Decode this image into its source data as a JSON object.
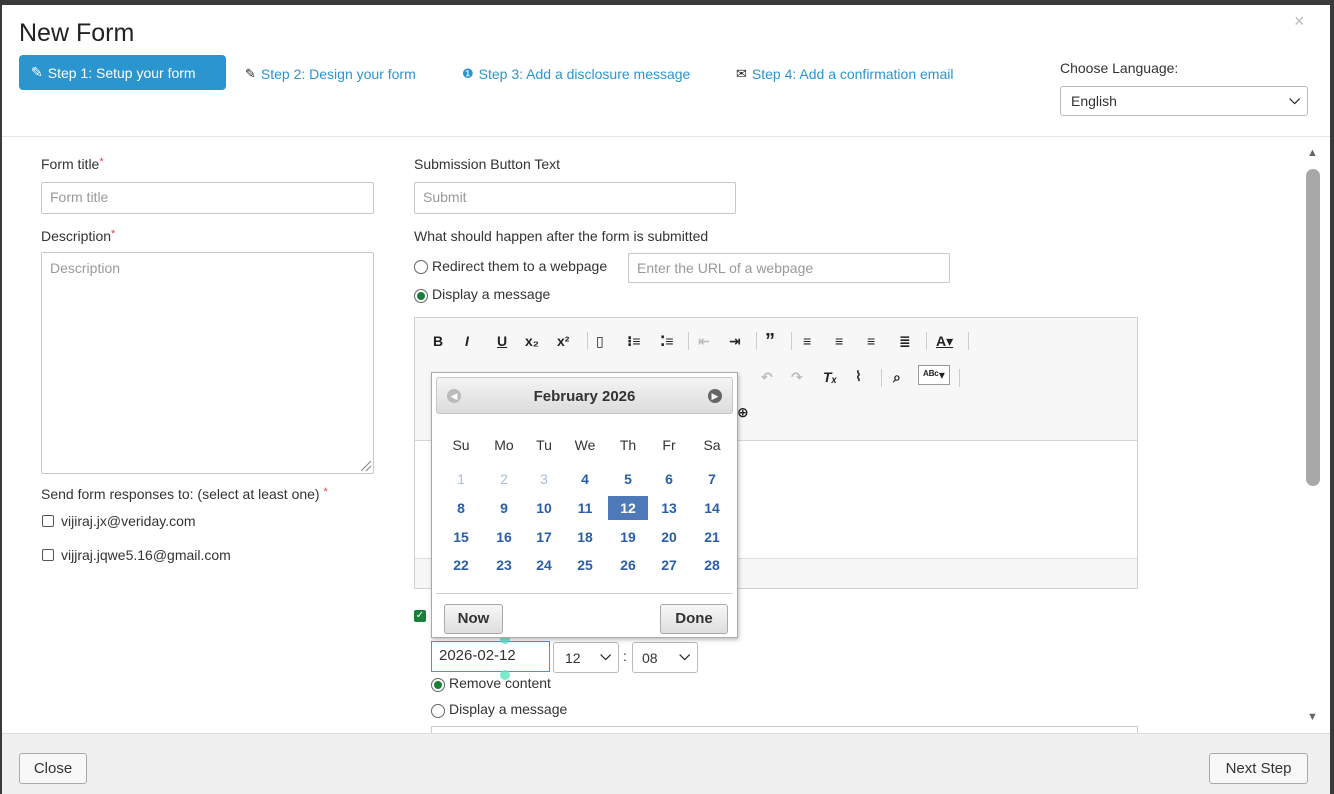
{
  "modal": {
    "title": "New Form",
    "close_icon": "×"
  },
  "steps": [
    {
      "icon": "✎",
      "label": "Step 1: Setup your form"
    },
    {
      "icon": "✎",
      "label": "Step 2: Design your form"
    },
    {
      "icon": "❶",
      "label": "Step 3: Add a disclosure message"
    },
    {
      "icon": "✉",
      "label": "Step 4: Add a confirmation email"
    }
  ],
  "language": {
    "label": "Choose Language:",
    "selected": "English"
  },
  "form": {
    "title_label": "Form title",
    "title_placeholder": "Form title",
    "required_mark": "*",
    "description_label": "Description",
    "description_placeholder": "Description",
    "send_label": "Send form responses to: (select at least one)",
    "recipients": [
      "vijiraj.jx@veriday.com",
      "vijjraj.jqwe5.16@gmail.com"
    ],
    "submit_label": "Submission Button Text",
    "submit_placeholder": "Submit",
    "after_label": "What should happen after the form is submitted",
    "redirect_label": "Redirect them to a webpage",
    "url_placeholder": "Enter the URL of a webpage",
    "display_label": "Display a message"
  },
  "datepicker": {
    "month_title": "February 2026",
    "prev_icon": "◀",
    "next_icon": "▶",
    "weekdays": [
      "Su",
      "Mo",
      "Tu",
      "We",
      "Th",
      "Fr",
      "Sa"
    ],
    "weeks": [
      [
        "1",
        "2",
        "3",
        "4",
        "5",
        "6",
        "7"
      ],
      [
        "8",
        "9",
        "10",
        "11",
        "12",
        "13",
        "14"
      ],
      [
        "15",
        "16",
        "17",
        "18",
        "19",
        "20",
        "21"
      ],
      [
        "22",
        "23",
        "24",
        "25",
        "26",
        "27",
        "28"
      ]
    ],
    "selected_day": "12",
    "now_label": "Now",
    "done_label": "Done"
  },
  "expiry": {
    "date_value": "2026-02-12",
    "hour": "12",
    "minute": "08",
    "time_sep": ":",
    "remove_label": "Remove content",
    "display_label": "Display a message"
  },
  "footer": {
    "close_label": "Close",
    "next_label": "Next Step"
  },
  "colors": {
    "accent": "#2b95cf",
    "check_green": "#1a7f37",
    "calendar_blue": "#2a5ea8",
    "selected_day": "#4d79b8"
  }
}
